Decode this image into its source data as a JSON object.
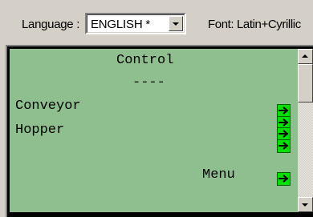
{
  "toolbar": {
    "language_label": "Language :",
    "language_value": "ENGLISH *",
    "font_label": "Font: Latin+Cyrillic"
  },
  "screen": {
    "title": "Control",
    "separator": "----",
    "items": [
      {
        "label": "Conveyor",
        "icon": "right-arrow-icon"
      },
      {
        "label": "Hopper",
        "icon": "right-arrow-icon"
      }
    ],
    "menu_label": "Menu"
  },
  "colors": {
    "background": "#d4d0c8",
    "screen": "#8fbf8f",
    "arrow_button": "#00e000"
  }
}
